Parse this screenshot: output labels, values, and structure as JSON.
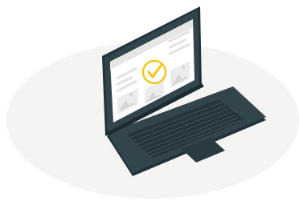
{
  "illustration": {
    "subject": "laptop",
    "screen_content": [
      "header-bar",
      "text-lines",
      "image-placeholder-left",
      "image-placeholder-right",
      "checkmark-badge"
    ],
    "badge_icon": "check-icon"
  },
  "colors": {
    "background_blob": "#f4f4f2",
    "laptop_body": "#33454c",
    "laptop_edge": "#22313a",
    "keyboard_keys": "#26353c",
    "screen_bg": "#ffffff",
    "screen_ui": "#e6e6e6",
    "screen_ui_dark": "#c9c9c9",
    "badge": "#f5c518"
  }
}
